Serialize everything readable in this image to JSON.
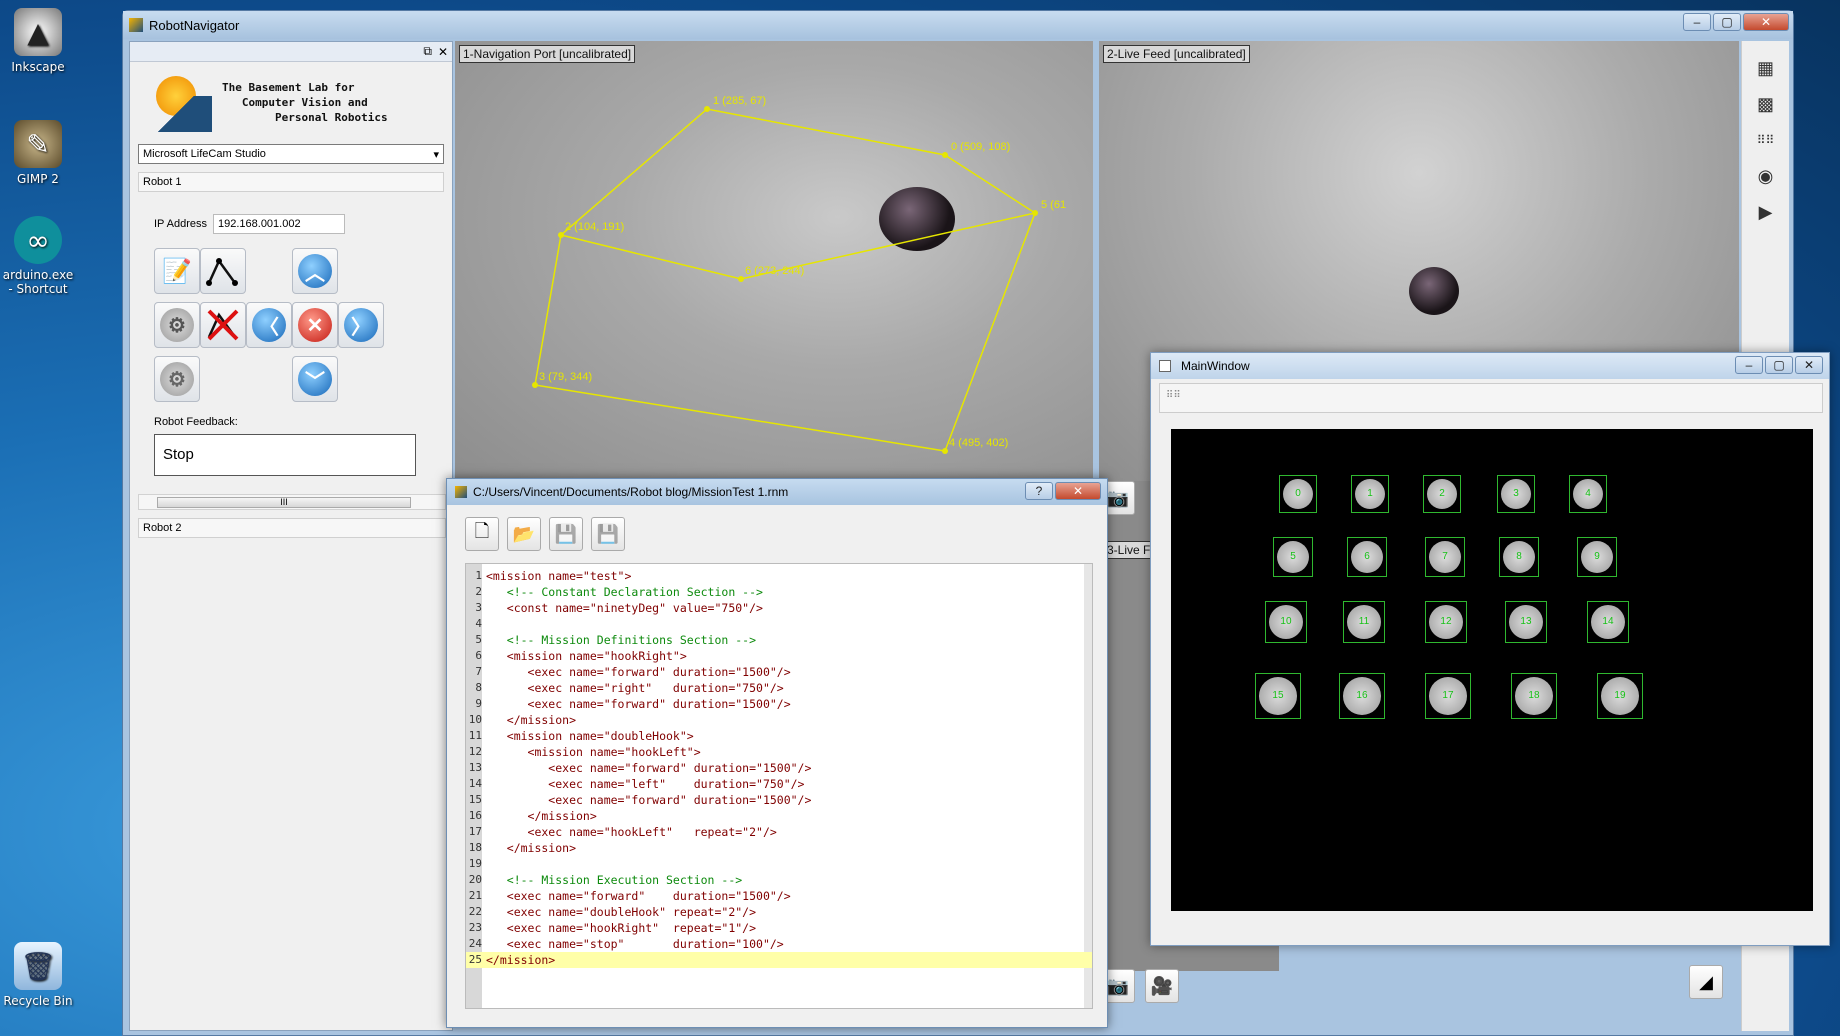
{
  "desktop": {
    "icons": [
      {
        "label": "Inkscape",
        "icon": "inkscape-icon"
      },
      {
        "label": "GIMP 2",
        "icon": "gimp-icon"
      },
      {
        "label": "arduino.exe - Shortcut",
        "icon": "arduino-icon"
      },
      {
        "label": "Recycle Bin",
        "icon": "recycle-bin-icon"
      }
    ]
  },
  "robotnav": {
    "title": "RobotNavigator",
    "lab_title": "The Basement Lab for\n   Computer Vision and\n        Personal Robotics",
    "camera_select": "Microsoft LifeCam Studio",
    "robot1_label": "Robot 1",
    "ip_label": "IP Address",
    "ip_value": "192.168.001.002",
    "feedback_label": "Robot Feedback:",
    "feedback_value": "Stop",
    "scroll_thumb": "III",
    "robot2_label": "Robot 2",
    "port1_label": "1-Navigation Port [uncalibrated]",
    "port2_label": "2-Live Feed [uncalibrated]",
    "port3_label_fragment": "3-Live F",
    "waypoints": [
      {
        "label": "0 (509, 108)"
      },
      {
        "label": "1 (285, 67)"
      },
      {
        "label": "2 (104, 191)"
      },
      {
        "label": "3 (79, 344)"
      },
      {
        "label": "4 (495, 402)"
      },
      {
        "label": "5 (61"
      },
      {
        "label": "6 (273, 244)"
      }
    ]
  },
  "editor": {
    "title": "C:/Users/Vincent/Documents/Robot blog/MissionTest 1.rnm",
    "help_btn": "?",
    "close_btn": "✕",
    "code": [
      {
        "n": "1",
        "t": "<mission name=\"test\">",
        "c": false
      },
      {
        "n": "2",
        "t": "   <!-- Constant Declaration Section -->",
        "c": true
      },
      {
        "n": "3",
        "t": "   <const name=\"ninetyDeg\" value=\"750\"/>",
        "c": false
      },
      {
        "n": "4",
        "t": "",
        "c": false
      },
      {
        "n": "5",
        "t": "   <!-- Mission Definitions Section -->",
        "c": true
      },
      {
        "n": "6",
        "t": "   <mission name=\"hookRight\">",
        "c": false
      },
      {
        "n": "7",
        "t": "      <exec name=\"forward\" duration=\"1500\"/>",
        "c": false
      },
      {
        "n": "8",
        "t": "      <exec name=\"right\"   duration=\"750\"/>",
        "c": false
      },
      {
        "n": "9",
        "t": "      <exec name=\"forward\" duration=\"1500\"/>",
        "c": false
      },
      {
        "n": "10",
        "t": "   </mission>",
        "c": false
      },
      {
        "n": "11",
        "t": "   <mission name=\"doubleHook\">",
        "c": false
      },
      {
        "n": "12",
        "t": "      <mission name=\"hookLeft\">",
        "c": false
      },
      {
        "n": "13",
        "t": "         <exec name=\"forward\" duration=\"1500\"/>",
        "c": false
      },
      {
        "n": "14",
        "t": "         <exec name=\"left\"    duration=\"750\"/>",
        "c": false
      },
      {
        "n": "15",
        "t": "         <exec name=\"forward\" duration=\"1500\"/>",
        "c": false
      },
      {
        "n": "16",
        "t": "      </mission>",
        "c": false
      },
      {
        "n": "17",
        "t": "      <exec name=\"hookLeft\"   repeat=\"2\"/>",
        "c": false
      },
      {
        "n": "18",
        "t": "   </mission>",
        "c": false
      },
      {
        "n": "19",
        "t": "",
        "c": false
      },
      {
        "n": "20",
        "t": "   <!-- Mission Execution Section -->",
        "c": true
      },
      {
        "n": "21",
        "t": "   <exec name=\"forward\"    duration=\"1500\"/>",
        "c": false
      },
      {
        "n": "22",
        "t": "   <exec name=\"doubleHook\" repeat=\"2\"/>",
        "c": false
      },
      {
        "n": "23",
        "t": "   <exec name=\"hookRight\"  repeat=\"1\"/>",
        "c": false
      },
      {
        "n": "24",
        "t": "   <exec name=\"stop\"       duration=\"100\"/>",
        "c": false
      },
      {
        "n": "25",
        "t": "</mission>",
        "c": false
      }
    ],
    "highlight_line": 25
  },
  "mainwindow": {
    "title": "MainWindow",
    "blobs": [
      "0",
      "1",
      "2",
      "3",
      "4",
      "5",
      "6",
      "7",
      "8",
      "9",
      "10",
      "11",
      "12",
      "13",
      "14",
      "15",
      "16",
      "17",
      "18",
      "19"
    ]
  }
}
